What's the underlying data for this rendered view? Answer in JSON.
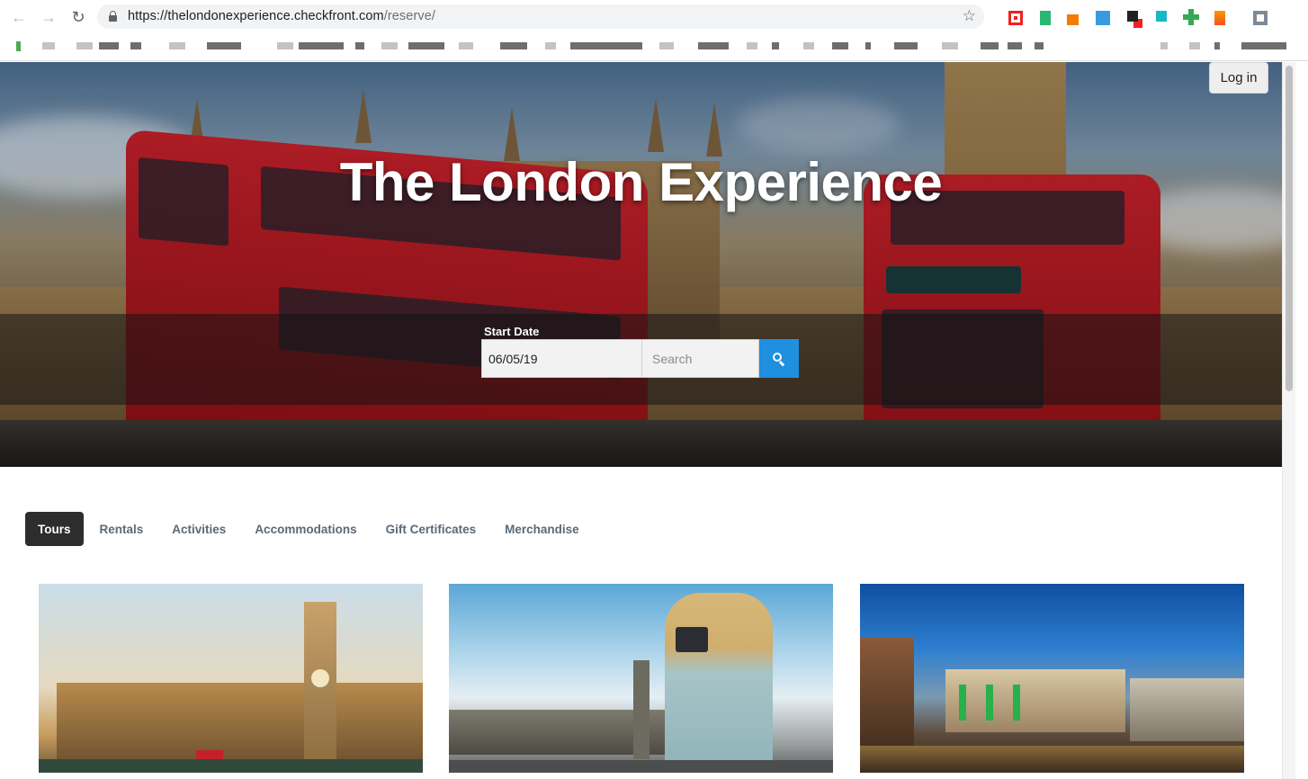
{
  "browser": {
    "url_host": "https://thelondonexperience.checkfront.com",
    "url_path": "/reserve/"
  },
  "header": {
    "login_label": "Log in"
  },
  "hero": {
    "title": "The London Experience",
    "start_date_label": "Start Date",
    "start_date_value": "06/05/19",
    "search_placeholder": "Search"
  },
  "categories": {
    "items": [
      {
        "label": "Tours",
        "active": true
      },
      {
        "label": "Rentals",
        "active": false
      },
      {
        "label": "Activities",
        "active": false
      },
      {
        "label": "Accommodations",
        "active": false
      },
      {
        "label": "Gift Certificates",
        "active": false
      },
      {
        "label": "Merchandise",
        "active": false
      }
    ]
  },
  "colors": {
    "accent": "#1f8fe0",
    "active_tab": "#2d2d2d",
    "tab_text": "#5a6a7a"
  }
}
